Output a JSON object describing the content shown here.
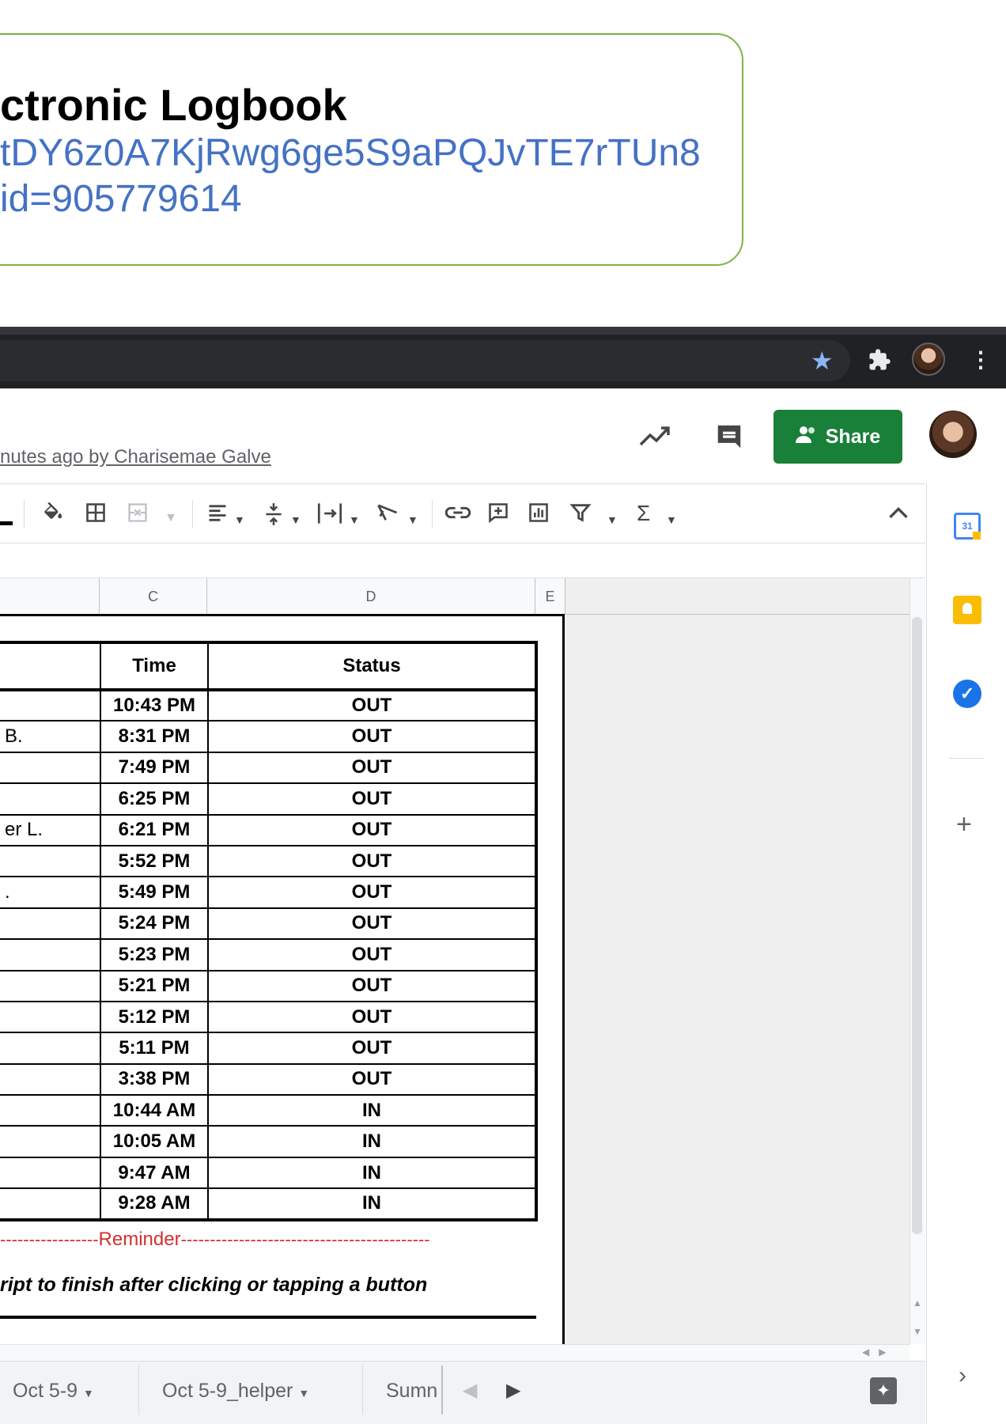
{
  "callout": {
    "title": "ctronic Logbook",
    "url_line1": "tDY6z0A7KjRwg6ge5S9aPQJvTE7rTUn8",
    "url_line2": "id=905779614"
  },
  "browser": {
    "icons": [
      "star-icon",
      "extensions-icon",
      "profile-avatar",
      "menu-kebab-icon"
    ]
  },
  "header": {
    "last_edit": "nutes ago by Charisemae Galve",
    "share_label": "Share"
  },
  "toolbar": {
    "icons": [
      "text-color-icon",
      "fill-color-icon",
      "borders-icon",
      "merge-cells-icon",
      "horizontal-align-icon",
      "vertical-align-icon",
      "text-wrapping-icon",
      "text-rotation-icon",
      "insert-link-icon",
      "insert-comment-icon",
      "insert-chart-icon",
      "filter-icon",
      "functions-icon",
      "collapse-icon"
    ]
  },
  "columns": [
    "C",
    "D",
    "E"
  ],
  "table": {
    "headers": {
      "time": "Time",
      "status": "Status"
    },
    "rows": [
      {
        "name": "",
        "time": "10:43 PM",
        "status": "OUT"
      },
      {
        "name": "B.",
        "time": "8:31 PM",
        "status": "OUT"
      },
      {
        "name": "",
        "time": "7:49 PM",
        "status": "OUT"
      },
      {
        "name": "",
        "time": "6:25 PM",
        "status": "OUT"
      },
      {
        "name": "er L.",
        "time": "6:21 PM",
        "status": "OUT"
      },
      {
        "name": "",
        "time": "5:52 PM",
        "status": "OUT"
      },
      {
        "name": ".",
        "time": "5:49 PM",
        "status": "OUT"
      },
      {
        "name": "",
        "time": "5:24 PM",
        "status": "OUT"
      },
      {
        "name": "",
        "time": "5:23 PM",
        "status": "OUT"
      },
      {
        "name": "",
        "time": "5:21 PM",
        "status": "OUT"
      },
      {
        "name": "",
        "time": "5:12 PM",
        "status": "OUT"
      },
      {
        "name": "",
        "time": "5:11 PM",
        "status": "OUT"
      },
      {
        "name": "",
        "time": "3:38 PM",
        "status": "OUT"
      },
      {
        "name": "",
        "time": "10:44 AM",
        "status": "IN"
      },
      {
        "name": "",
        "time": "10:05 AM",
        "status": "IN"
      },
      {
        "name": "",
        "time": "9:47 AM",
        "status": "IN"
      },
      {
        "name": "",
        "time": "9:28 AM",
        "status": "IN"
      }
    ]
  },
  "reminder": {
    "dashes_left": "-----------------",
    "label": "Reminder",
    "dashes_right": "-------------------------------------------",
    "note": "ript to finish after clicking or tapping a button"
  },
  "side_panel": {
    "calendar_day": "31",
    "icons": [
      "calendar-icon",
      "keep-icon",
      "tasks-icon",
      "add-addon-icon",
      "expand-panel-icon"
    ]
  },
  "sheet_tabs": [
    {
      "label": "Oct 5-9"
    },
    {
      "label": "Oct 5-9_helper"
    },
    {
      "label": "Sumn"
    }
  ]
}
